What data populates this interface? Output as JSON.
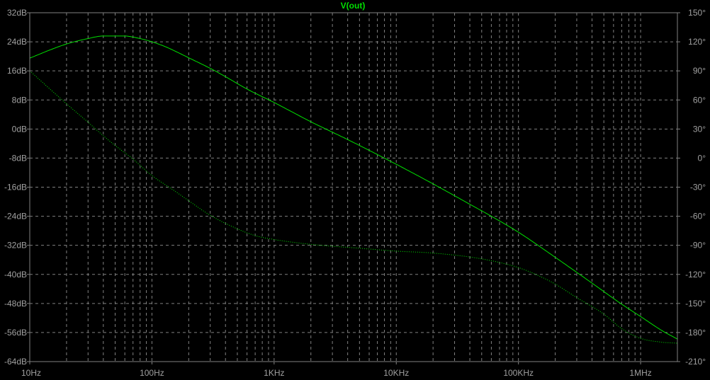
{
  "chart_data": {
    "type": "line",
    "title": "V(out)",
    "x_scale": "log",
    "x_unit": "Hz",
    "x_range": [
      10,
      2000000
    ],
    "x_ticks": [
      {
        "value": 10,
        "label": "10Hz"
      },
      {
        "value": 100,
        "label": "100Hz"
      },
      {
        "value": 1000,
        "label": "1KHz"
      },
      {
        "value": 10000,
        "label": "10KHz"
      },
      {
        "value": 100000,
        "label": "100KHz"
      },
      {
        "value": 1000000,
        "label": "1MHz"
      }
    ],
    "y_left": {
      "unit": "dB",
      "range": [
        -64,
        32
      ],
      "ticks": [
        {
          "value": 32,
          "label": "32dB"
        },
        {
          "value": 24,
          "label": "24dB"
        },
        {
          "value": 16,
          "label": "16dB"
        },
        {
          "value": 8,
          "label": "8dB"
        },
        {
          "value": 0,
          "label": "0dB"
        },
        {
          "value": -8,
          "label": "-8dB"
        },
        {
          "value": -16,
          "label": "-16dB"
        },
        {
          "value": -24,
          "label": "-24dB"
        },
        {
          "value": -32,
          "label": "-32dB"
        },
        {
          "value": -40,
          "label": "-40dB"
        },
        {
          "value": -48,
          "label": "-48dB"
        },
        {
          "value": -56,
          "label": "-56dB"
        },
        {
          "value": -64,
          "label": "-64dB"
        }
      ]
    },
    "y_right": {
      "unit": "degrees",
      "range": [
        -210,
        150
      ],
      "ticks": [
        {
          "value": 150,
          "label": "150°"
        },
        {
          "value": 120,
          "label": "120°"
        },
        {
          "value": 90,
          "label": "90°"
        },
        {
          "value": 60,
          "label": "60°"
        },
        {
          "value": 30,
          "label": "30°"
        },
        {
          "value": 0,
          "label": "0°"
        },
        {
          "value": -30,
          "label": "-30°"
        },
        {
          "value": -60,
          "label": "-60°"
        },
        {
          "value": -90,
          "label": "-90°"
        },
        {
          "value": -120,
          "label": "-120°"
        },
        {
          "value": -150,
          "label": "-150°"
        },
        {
          "value": -180,
          "label": "-180°"
        },
        {
          "value": -210,
          "label": "-210°"
        }
      ]
    },
    "grid": true,
    "colors": {
      "background": "#000000",
      "trace": "#00e000",
      "grid": "#808080",
      "tick_text": "#a0a0a0"
    },
    "series": [
      {
        "axis": "left",
        "style": "solid",
        "x": [
          10,
          15,
          20,
          30,
          40,
          50,
          60,
          70,
          80,
          100,
          130,
          160,
          200,
          300,
          400,
          600,
          1000,
          2000,
          4000,
          10000,
          20000,
          40000,
          60000,
          100000,
          200000,
          400000,
          700000,
          1000000,
          1500000,
          2000000
        ],
        "y": [
          19.5,
          21.9,
          23.4,
          24.9,
          25.6,
          25.6,
          25.6,
          25.3,
          24.9,
          24,
          22.6,
          21.2,
          19.6,
          16.7,
          14.4,
          11,
          7.3,
          2,
          -2.9,
          -9.7,
          -15.1,
          -20.7,
          -24,
          -28.4,
          -35.3,
          -42.4,
          -48.2,
          -51.6,
          -55.5,
          -57.8
        ]
      },
      {
        "axis": "right",
        "style": "dotted",
        "x": [
          10,
          15,
          20,
          30,
          40,
          50,
          70,
          100,
          150,
          200,
          300,
          500,
          700,
          1000,
          2000,
          5000,
          10000,
          20000,
          50000,
          100000,
          150000,
          200000,
          300000,
          500000,
          700000,
          1000000,
          1500000,
          2000000
        ],
        "y": [
          90,
          70,
          56,
          37,
          23,
          13,
          -1,
          -18,
          -33,
          -44,
          -59,
          -73,
          -80,
          -84,
          -89,
          -93,
          -96,
          -98,
          -104,
          -113,
          -122,
          -130,
          -144,
          -161,
          -176,
          -186,
          -190,
          -191
        ]
      }
    ]
  }
}
